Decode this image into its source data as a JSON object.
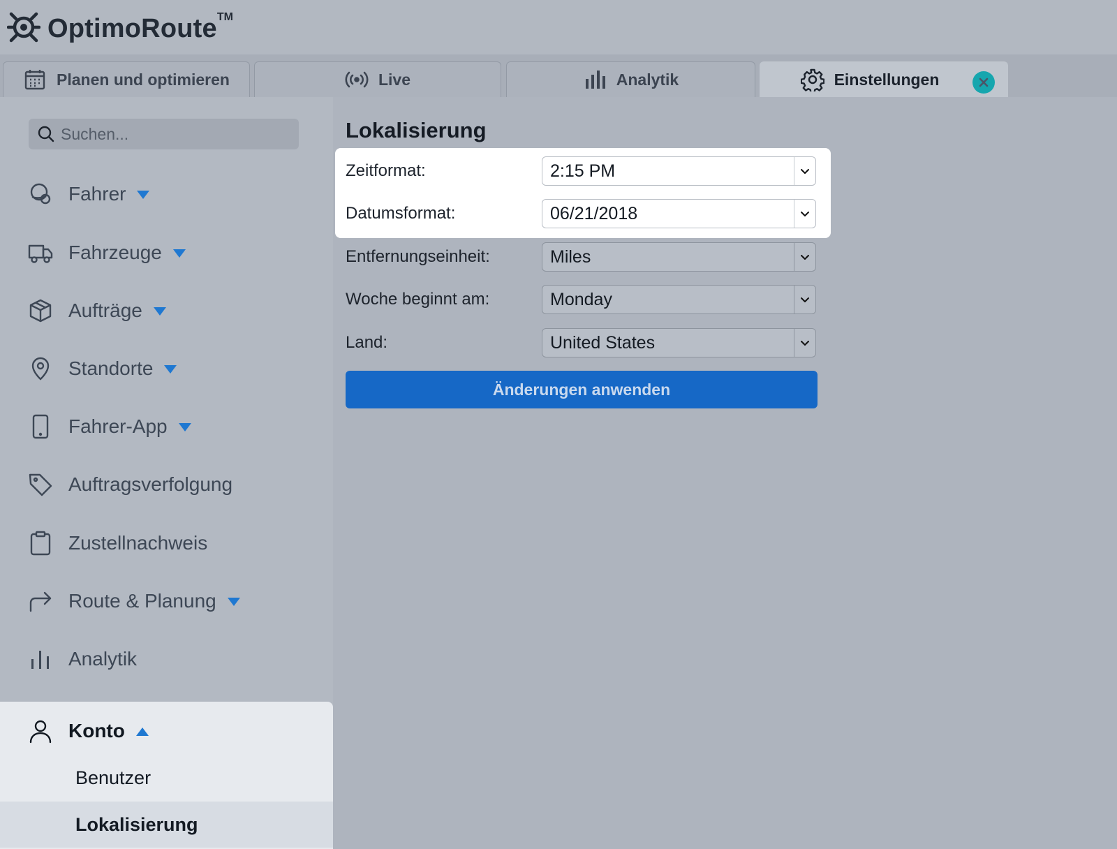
{
  "app": {
    "name": "OptimoRoute",
    "tm": "TM"
  },
  "tabs": [
    {
      "label": "Planen und optimieren",
      "icon": "calendar-icon",
      "active": false
    },
    {
      "label": "Live",
      "icon": "broadcast-icon",
      "active": false
    },
    {
      "label": "Analytik",
      "icon": "bar-chart-icon",
      "active": false
    },
    {
      "label": "Einstellungen",
      "icon": "gear-icon",
      "active": true
    }
  ],
  "sidebar": {
    "search_placeholder": "Suchen...",
    "items": [
      {
        "label": "Fahrer",
        "icon": "steering-wheel-icon",
        "caret": "down"
      },
      {
        "label": "Fahrzeuge",
        "icon": "truck-icon",
        "caret": "down"
      },
      {
        "label": "Aufträge",
        "icon": "package-icon",
        "caret": "down"
      },
      {
        "label": "Standorte",
        "icon": "map-pin-icon",
        "caret": "down"
      },
      {
        "label": "Fahrer-App",
        "icon": "smartphone-icon",
        "caret": "down"
      },
      {
        "label": "Auftragsverfolgung",
        "icon": "tag-icon",
        "caret": "none"
      },
      {
        "label": "Zustellnachweis",
        "icon": "clipboard-icon",
        "caret": "none"
      },
      {
        "label": "Route & Planung",
        "icon": "route-arrow-icon",
        "caret": "down"
      },
      {
        "label": "Analytik",
        "icon": "bar-chart-icon",
        "caret": "none"
      },
      {
        "label": "Konto",
        "icon": "user-icon",
        "caret": "up"
      }
    ],
    "sub_items": [
      {
        "label": "Benutzer",
        "selected": false
      },
      {
        "label": "Lokalisierung",
        "selected": true
      }
    ]
  },
  "main": {
    "title": "Lokalisierung",
    "fields": [
      {
        "label": "Zeitformat:",
        "value": "2:15 PM"
      },
      {
        "label": "Datumsformat:",
        "value": "06/21/2018"
      },
      {
        "label": "Entfernungseinheit:",
        "value": "Miles"
      },
      {
        "label": "Woche beginnt am:",
        "value": "Monday"
      },
      {
        "label": "Land:",
        "value": "United States"
      }
    ],
    "apply_label": "Änderungen anwenden"
  },
  "colors": {
    "accent_blue": "#1668c6",
    "caret_blue": "#1f78d1",
    "close_teal": "#16a6ae"
  }
}
